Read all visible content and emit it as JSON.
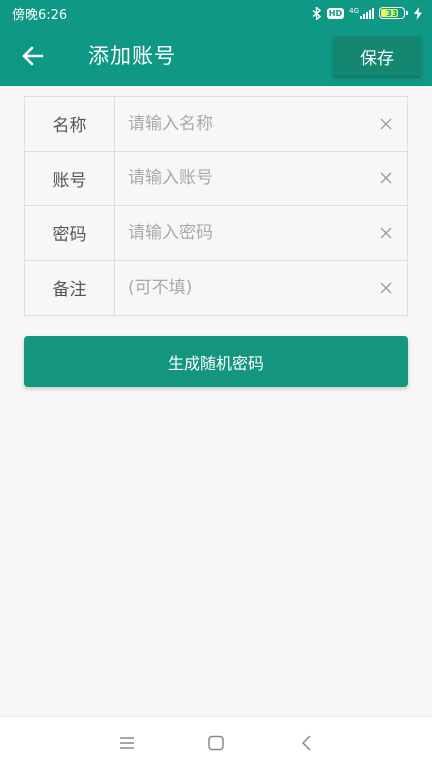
{
  "status_bar": {
    "time": "傍晚6:26",
    "hd": "HD",
    "network": "4G",
    "battery_percent": "33",
    "icons": [
      "bluetooth-icon",
      "signal-icon",
      "battery-icon",
      "charging-icon"
    ]
  },
  "app_bar": {
    "title": "添加账号",
    "save_label": "保存",
    "back_icon": "arrow-left-icon",
    "background_color": "#0f9985"
  },
  "form": {
    "rows": [
      {
        "label": "名称",
        "placeholder": "请输入名称",
        "value": ""
      },
      {
        "label": "账号",
        "placeholder": "请输入账号",
        "value": ""
      },
      {
        "label": "密码",
        "placeholder": "请输入密码",
        "value": ""
      },
      {
        "label": "备注",
        "placeholder": "(可不填)",
        "value": ""
      }
    ],
    "clear_icon": "close-icon"
  },
  "generate_button": {
    "label": "生成随机密码",
    "color": "#13957f"
  },
  "nav_bar": {
    "icons": [
      "menu-icon",
      "home-square-icon",
      "back-chevron-icon"
    ]
  }
}
